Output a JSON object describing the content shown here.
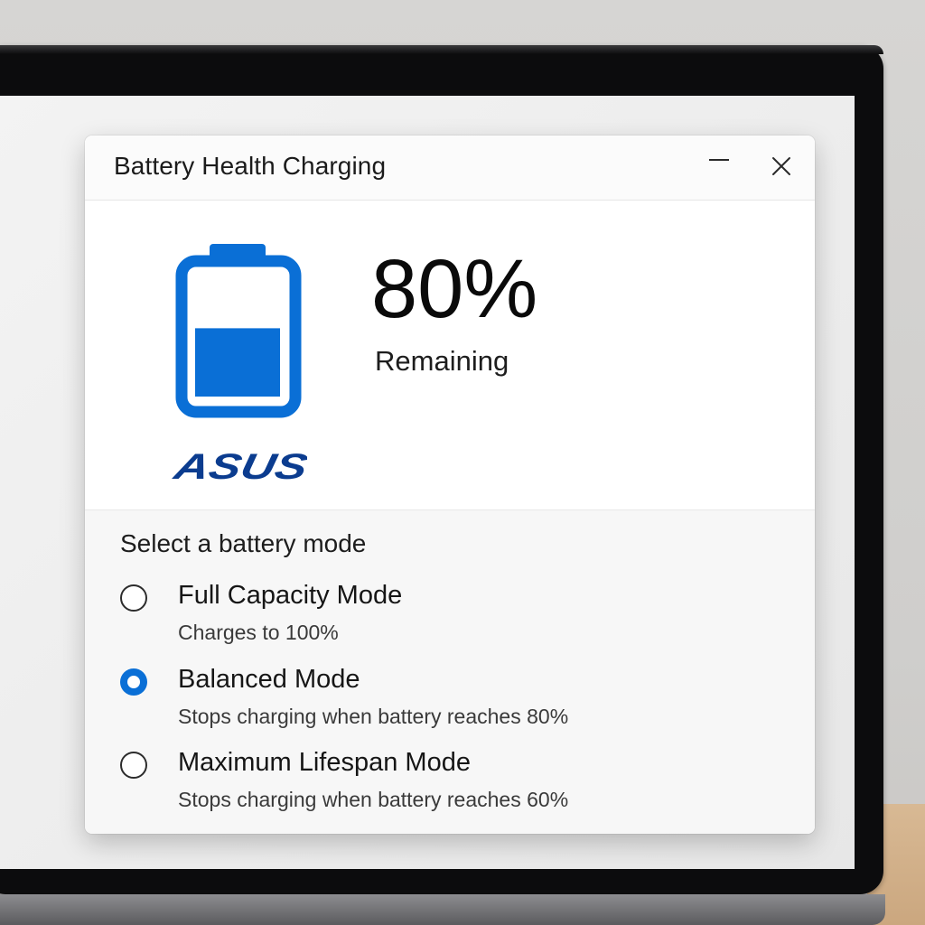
{
  "window": {
    "title": "Battery Health Charging",
    "minimize_icon": "minimize-icon",
    "close_icon": "close-icon"
  },
  "status": {
    "percent": "80%",
    "percent_value": 80,
    "label": "Remaining",
    "battery_icon": "battery-icon",
    "accent_color": "#0a6fd6",
    "logo_text": "ASUS",
    "logo_color": "#0b3c8f"
  },
  "modes": {
    "heading": "Select a battery mode",
    "options": [
      {
        "label": "Full Capacity Mode",
        "description": "Charges to 100%",
        "selected": false
      },
      {
        "label": "Balanced Mode",
        "description": "Stops charging when battery reaches 80%",
        "selected": true
      },
      {
        "label": "Maximum Lifespan Mode",
        "description": "Stops charging when battery reaches 60%",
        "selected": false
      }
    ]
  }
}
